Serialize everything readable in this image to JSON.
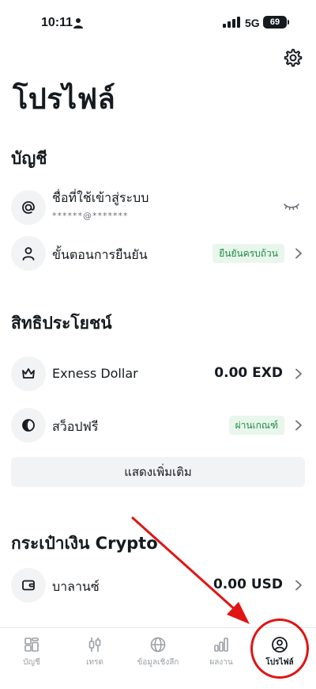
{
  "status": {
    "time": "10:11",
    "network": "5G",
    "battery": "69"
  },
  "page": {
    "title": "โปรไฟล์"
  },
  "account": {
    "title": "บัญชี",
    "username": {
      "label": "ชื่อที่ใช้เข้าสู่ระบบ",
      "masked": "******@*******"
    },
    "verification": {
      "label": "ขั้นตอนการยืนยัน",
      "badge": "ยืนยันครบถ้วน"
    }
  },
  "benefits": {
    "title": "สิทธิประโยชน์",
    "exness_dollar": {
      "label": "Exness Dollar",
      "value": "0.00 EXD"
    },
    "swap_free": {
      "label": "สว็อปฟรี",
      "badge": "ผ่านเกณฑ์"
    },
    "show_more": "แสดงเพิ่มเติม"
  },
  "crypto": {
    "title": "กระเป๋าเงิน Crypto",
    "balance": {
      "label": "บาลานซ์",
      "value": "0.00 USD"
    }
  },
  "tabs": [
    {
      "label": "บัญชี",
      "icon": "grid-icon",
      "active": false
    },
    {
      "label": "เทรด",
      "icon": "candlestick-icon",
      "active": false
    },
    {
      "label": "ข้อมูลเชิงลึก",
      "icon": "globe-icon",
      "active": false
    },
    {
      "label": "ผลงาน",
      "icon": "bar-chart-icon",
      "active": false
    },
    {
      "label": "โปรไฟล์",
      "icon": "profile-icon",
      "active": true
    }
  ],
  "colors": {
    "badge_bg": "#e8f6ec",
    "badge_text": "#1e8c44",
    "annotation": "#e01414"
  }
}
